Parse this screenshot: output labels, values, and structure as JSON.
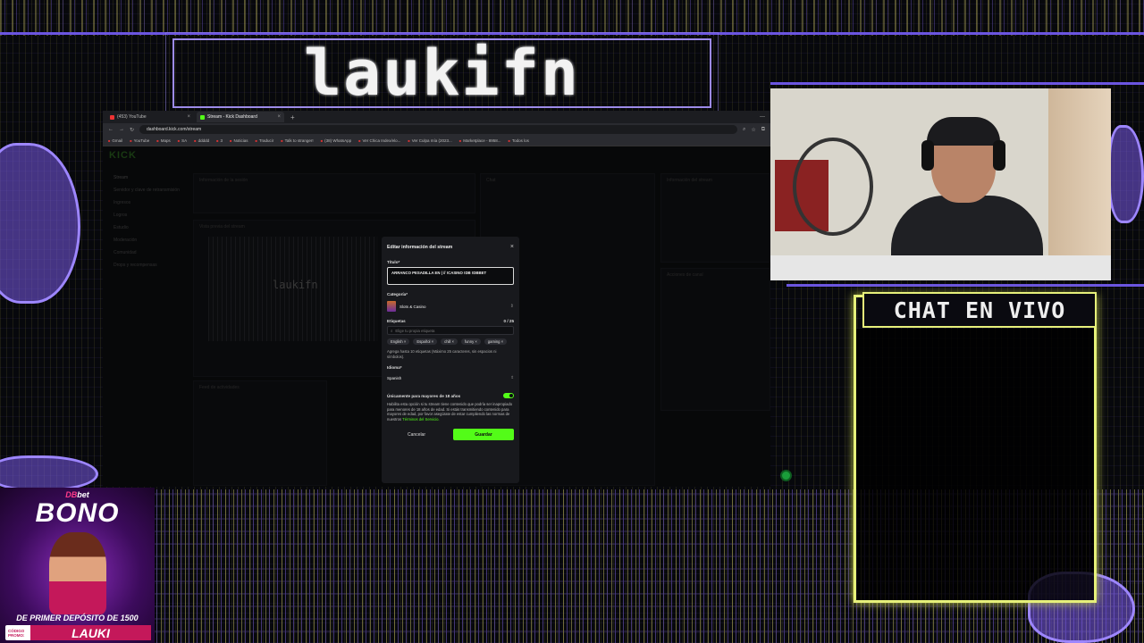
{
  "overlay": {
    "brand": "laukifn",
    "chat_header": "CHAT EN VIVO"
  },
  "browser": {
    "tabs": [
      {
        "label": "(453) YouTube",
        "color": "#e33"
      },
      {
        "label": "Stream - Kick Dashboard",
        "color": "#53fc18"
      }
    ],
    "tab_add": "+",
    "url": "dashboard.kick.com/stream",
    "bookmarks": [
      "Gmail",
      "YouTube",
      "Maps",
      "SA",
      "ddddd",
      "3",
      "Noticias",
      "Traducir",
      "Talk to stranger!",
      "(38) WhatsApp",
      "Ver Chica Index/elo...",
      "Ver Culpa mía (2023...",
      "Marketplace - 8958..."
    ],
    "all_bookmarks": "Todos los"
  },
  "dashboard": {
    "logo": "KICK",
    "sidebar": [
      "Stream",
      "Servidor y clave de retransmisión",
      "Ingresos",
      "Logros",
      "Estudio",
      "Moderación",
      "Comunidad",
      "Drops y recompensas"
    ],
    "session_title": "Información de la sesión",
    "preview_title": "Vista previa del stream",
    "preview_brand": "laukifn",
    "activity_title": "Feed de actividades",
    "chat_title": "Chat",
    "info_title": "Información del stream",
    "actions_title": "Acciones de canal"
  },
  "modal": {
    "title": "Editar información del stream",
    "close": "×",
    "title_label": "Título*",
    "title_value": "ARRANCO PESADILLA EN | // !CASINO !DB !DBBET",
    "category_label": "Categoría*",
    "category_value": "Slots & Casino",
    "tags_label": "Etiquetas",
    "tags_count": "0 / 25",
    "tags_placeholder": "Elige tu propia etiqueta",
    "tags": [
      "English ×",
      "Español ×",
      "chill ×",
      "funny ×",
      "gaming ×"
    ],
    "tags_help": "Agrega hasta 10 etiquetas (Máximo 25 caracteres, sin espacios ni símbolos).",
    "language_label": "Idioma*",
    "language_value": "Spanish",
    "adult_label": "Únicamente para mayores de 18 años",
    "adult_desc": "Habilita esta opción si tu stream tiene contenido que podría ser inapropiado para menores de 18 años de edad. Si estás transmitiendo contenido para mayores de edad, por favor asegúrate de estar cumpliendo las normas de nuestros",
    "adult_link": "Términos del Servicio.",
    "cancel": "Cancelar",
    "save": "Guardar"
  },
  "promo": {
    "logo_a": "DB",
    "logo_b": "bet",
    "headline": "BONO",
    "deposit": "DE PRIMER DEPÓSITO DE 1500",
    "code_label": "CÓDIGO PROMO:",
    "code": "LAUKI"
  },
  "colors": {
    "kick_green": "#53fc18",
    "overlay_yellow": "#e6f07a",
    "overlay_purple": "#6b55e0"
  }
}
